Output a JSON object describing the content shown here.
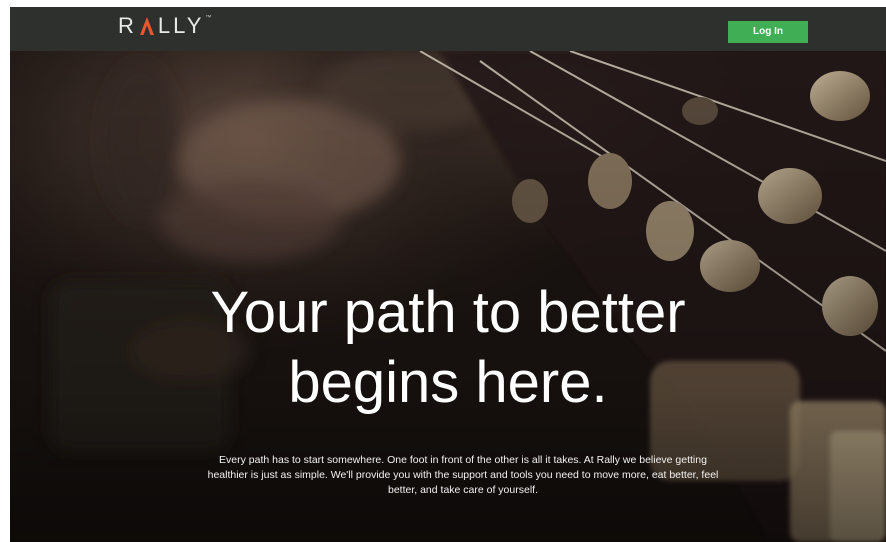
{
  "header": {
    "logo_text": "RALLY",
    "logo_trademark": "™",
    "login_label": "Log In"
  },
  "hero": {
    "headline_line1": "Your path to better",
    "headline_line2": "begins here.",
    "body": "Every path has to start somewhere. One foot in front of the other is all it takes. At Rally we believe getting healthier is just as simple. We'll provide you with the support and tools you need to move more, eat better, feel better, and take care of yourself.",
    "background_image": "guitar-headstock-photo"
  },
  "colors": {
    "header_bg": "#2e302e",
    "login_button": "#3fae55",
    "logo_accent": "#e8572f",
    "hero_text": "#ffffff"
  }
}
